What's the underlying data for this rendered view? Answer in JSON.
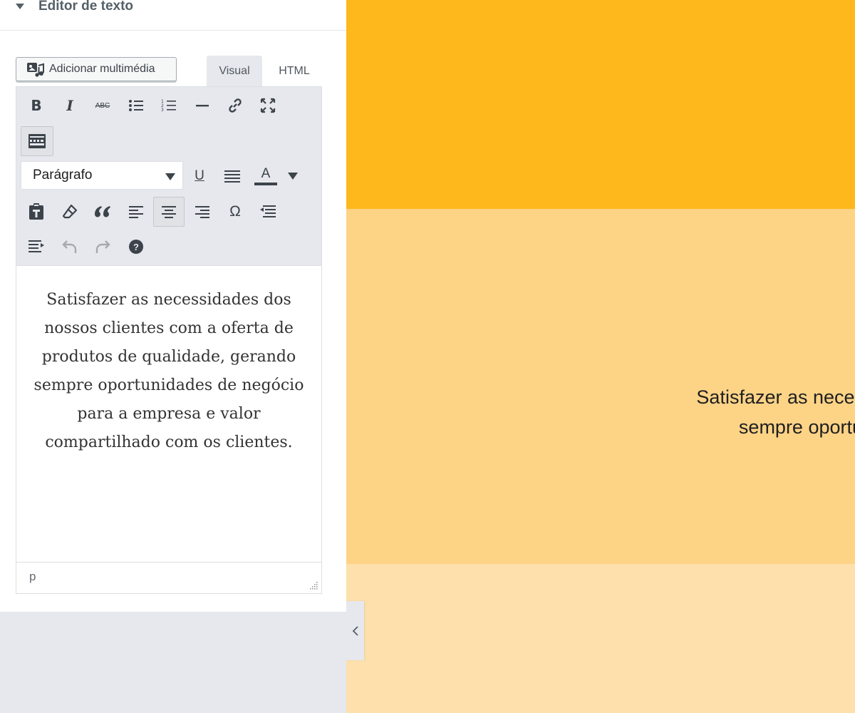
{
  "panel": {
    "section_title": "Editor de texto",
    "media_button_label": "Adicionar multimédia",
    "tabs": {
      "visual": "Visual",
      "html": "HTML"
    },
    "toolbar": {
      "bold": "B",
      "italic": "I",
      "strikethrough": "ABC",
      "format_select_value": "Parágrafo",
      "underline": "U",
      "text_color": "A",
      "special_char": "Ω",
      "help": "?"
    },
    "editor_content": "Satisfazer as necessidades dos nossos clientes com a oferta de produtos de qualidade, gerando sempre oportunidades de negócio para a empresa e valor compartilhado com os clientes.",
    "status_path": "p"
  },
  "preview": {
    "line1": "Satisfazer as necessida",
    "line2": "sempre oportunidad"
  },
  "colors": {
    "accent_band_top": "#feb81c",
    "accent_band_middle": "#fdd386",
    "accent_band_bottom": "#fde0ab",
    "toolbar_bg": "#e6e8ed"
  }
}
